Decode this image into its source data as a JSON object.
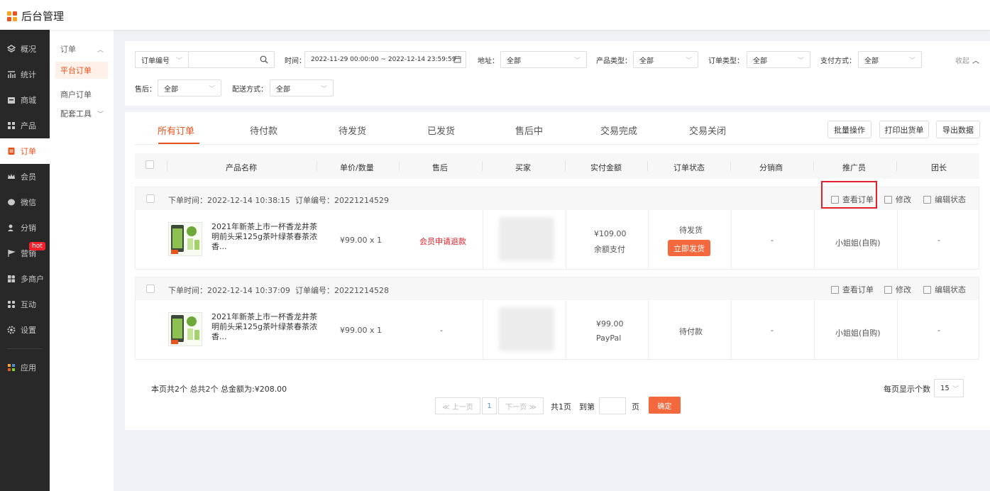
{
  "app": {
    "title": "后台管理"
  },
  "sidebar": {
    "items": [
      {
        "label": "概况",
        "icon": "dashboard-icon"
      },
      {
        "label": "统计",
        "icon": "chart-icon"
      },
      {
        "label": "商城",
        "icon": "store-icon"
      },
      {
        "label": "产品",
        "icon": "product-icon"
      },
      {
        "label": "订单",
        "icon": "order-icon"
      },
      {
        "label": "会员",
        "icon": "crown-icon"
      },
      {
        "label": "微信",
        "icon": "wechat-icon"
      },
      {
        "label": "分销",
        "icon": "distribution-icon"
      },
      {
        "label": "营销",
        "icon": "marketing-icon"
      },
      {
        "label": "多商户",
        "icon": "merchant-icon"
      },
      {
        "label": "互动",
        "icon": "interaction-icon"
      },
      {
        "label": "设置",
        "icon": "gear-icon"
      },
      {
        "label": "应用",
        "icon": "apps-icon"
      }
    ],
    "hot_badge": "hot",
    "active_index": 4
  },
  "subnav": {
    "group_label": "订单",
    "items": [
      "平台订单",
      "商户订单"
    ],
    "tools_label": "配套工具"
  },
  "filters": {
    "order_no_select": "订单编号",
    "order_no_placeholder": "",
    "time_label": "时间：",
    "time_range": "2022-11-29 00:00:00 ~ 2022-12-14 23:59:59",
    "address_label": "地址：",
    "address_value": "全部",
    "product_type_label": "产品类型：",
    "product_type_value": "全部",
    "order_type_label": "订单类型：",
    "order_type_value": "全部",
    "payment_label": "支付方式：",
    "payment_value": "全部",
    "collapse_label": "收起",
    "after_sale_label": "售后：",
    "after_sale_value": "全部",
    "delivery_label": "配送方式：",
    "delivery_value": "全部"
  },
  "tabs": [
    "所有订单",
    "待付款",
    "待发货",
    "已发货",
    "售后中",
    "交易完成",
    "交易关闭"
  ],
  "toolbar": {
    "batch_label": "批量操作",
    "print_label": "打印出货单",
    "export_label": "导出数据"
  },
  "table": {
    "headers": [
      "产品名称",
      "单价/数量",
      "售后",
      "买家",
      "实付金额",
      "订单状态",
      "分销商",
      "推广员",
      "团长"
    ],
    "orders": [
      {
        "time_text": "下单时间：2022-12-14 10:38:15",
        "no_text": "订单编号：20221214529",
        "product_name": "2021年新茶上市一杯香龙井茶明前头采125g茶叶绿茶春茶浓香...",
        "price_qty": "¥99.00   x 1",
        "after_sale": "会员申请退款",
        "amount": "¥109.00",
        "pay_method": "余额支付",
        "status": "待发货",
        "ship_button": "立即发货",
        "distributor": "-",
        "promoter": "小姐姐(自购)",
        "leader": "-"
      },
      {
        "time_text": "下单时间：2022-12-14 10:37:09",
        "no_text": "订单编号：20221214528",
        "product_name": "2021年新茶上市一杯香龙井茶明前头采125g茶叶绿茶春茶浓香...",
        "price_qty": "¥99.00   x 1",
        "after_sale": "-",
        "amount": "¥99.00",
        "pay_method": "PayPal",
        "status": "待付款",
        "ship_button": "",
        "distributor": "-",
        "promoter": "小姐姐(自购)",
        "leader": "-"
      }
    ],
    "actions": {
      "view_label": "查看订单",
      "edit_label": "修改",
      "status_label": "编辑状态"
    }
  },
  "pagination": {
    "summary": "本页共2个  总共2个  总金额为:¥208.00",
    "prev_label": "≪ 上一页",
    "page": "1",
    "next_label": "下一页 ≫",
    "total_pages": "共1页",
    "goto_label": "到第",
    "page_unit": "页",
    "confirm_label": "确定",
    "page_size_label": "每页显示个数",
    "page_size_value": "15"
  },
  "colors": {
    "accent": "#e8541e",
    "button": "#f3693d",
    "sidebar_bg": "#282828",
    "highlight_box": "#e0202a"
  }
}
